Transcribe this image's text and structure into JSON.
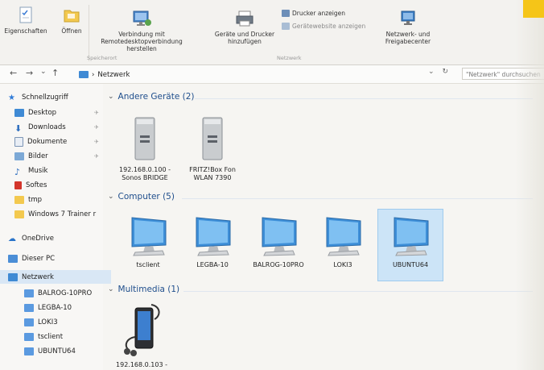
{
  "ribbon": {
    "props_label": "Eigenschaften",
    "open_label": "Öffnen",
    "remote_label_1": "Verbindung mit",
    "remote_label_2": "Remotedesktopverbindung herstellen",
    "devices_label_1": "Geräte und Drucker",
    "devices_label_2": "hinzufügen",
    "printers_label": "Drucker anzeigen",
    "devsites_label": "Gerätewebsite anzeigen",
    "netcenter_label_1": "Netzwerk- und",
    "netcenter_label_2": "Freigabecenter",
    "group_location": "Speicherort",
    "group_network": "Netzwerk"
  },
  "address": {
    "back": "←",
    "forward": "→",
    "recent": "⌄",
    "up": "↑",
    "sep": "›",
    "path": "Netzwerk",
    "dropdown": "⌄",
    "refresh": "↻",
    "search_placeholder": "\"Netzwerk\" durchsuchen"
  },
  "sidebar": {
    "quick_access": "Schnellzugriff",
    "items": [
      {
        "label": "Desktop",
        "pinned": true
      },
      {
        "label": "Downloads",
        "pinned": true
      },
      {
        "label": "Dokumente",
        "pinned": true
      },
      {
        "label": "Bilder",
        "pinned": true
      },
      {
        "label": "Musik",
        "pinned": false
      },
      {
        "label": "Softes",
        "pinned": false
      },
      {
        "label": "tmp",
        "pinned": false
      },
      {
        "label": "Windows 7 Trainer r",
        "pinned": false
      }
    ],
    "onedrive": "OneDrive",
    "this_pc": "Dieser PC",
    "network": "Netzwerk",
    "network_children": [
      "BALROG-10PRO",
      "LEGBA-10",
      "LOKI3",
      "tsclient",
      "UBUNTU64"
    ],
    "pin_glyph": "✈"
  },
  "content": {
    "groups": [
      {
        "title": "Andere Geräte (2)",
        "items": [
          {
            "line1": "192.168.0.100 -",
            "line2": "Sonos BRIDGE"
          },
          {
            "line1": "FRITZ!Box Fon",
            "line2": "WLAN 7390"
          }
        ]
      },
      {
        "title": "Computer (5)",
        "items": [
          {
            "line1": "tsclient"
          },
          {
            "line1": "LEGBA-10"
          },
          {
            "line1": "BALROG-10PRO"
          },
          {
            "line1": "LOKI3"
          },
          {
            "line1": "UBUNTU64"
          }
        ]
      },
      {
        "title": "Multimedia (1)",
        "items": [
          {
            "line1": "192.168.0.103 -"
          }
        ]
      }
    ],
    "chevron": "⌄"
  },
  "colors": {
    "accent": "#1f4e8c",
    "selection": "#cce4f7",
    "folder_blue": "#3f8ad4",
    "folder_yellow": "#f3c94f"
  }
}
